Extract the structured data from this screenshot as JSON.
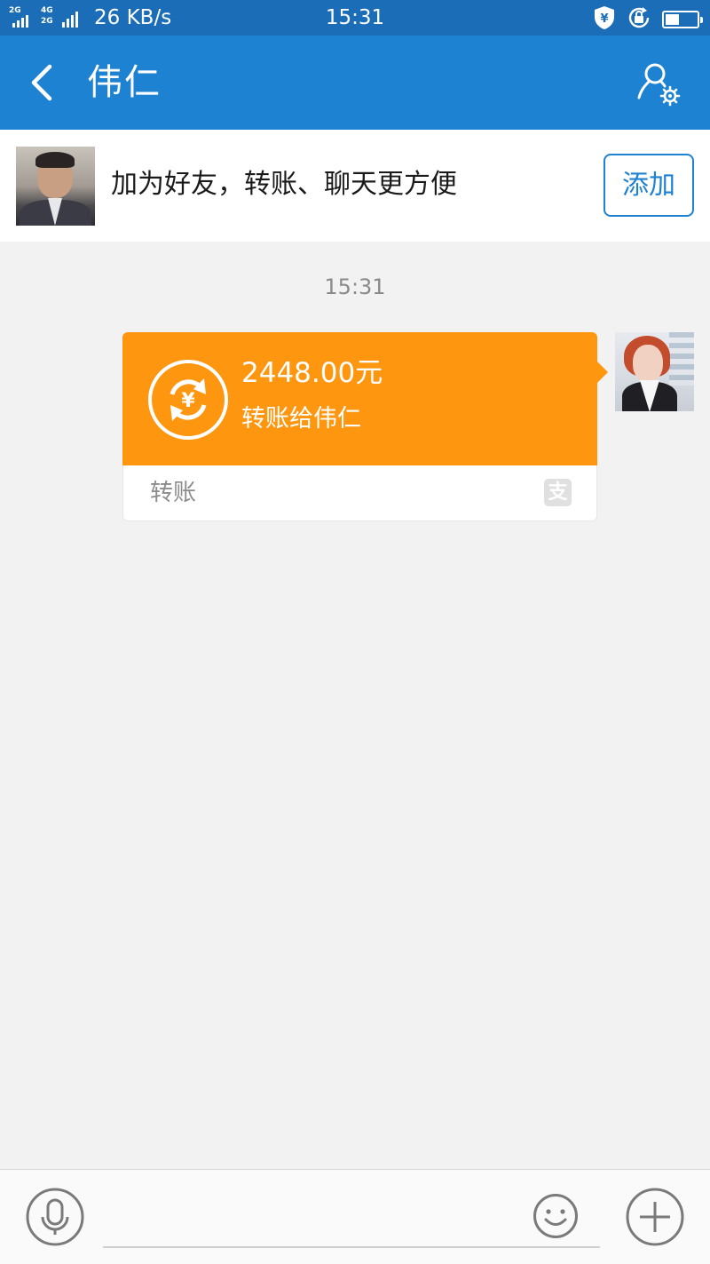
{
  "status_bar": {
    "sim1_network": "2G",
    "sim2_network_top": "4G",
    "sim2_network_bottom": "2G",
    "speed": "26 KB/s",
    "time": "15:31",
    "battery_level": 0.45,
    "icons": [
      "signal-icon",
      "signal-icon",
      "shield-yuan-icon",
      "lock-rotation-icon",
      "battery-icon"
    ]
  },
  "header": {
    "title": "伟仁",
    "back_icon": "chevron-left-icon",
    "profile_icon": "user-settings-icon",
    "bg_color": "#1e82d2"
  },
  "add_friend_banner": {
    "text": "加为好友，转账、聊天更方便",
    "button_label": "添加"
  },
  "chat": {
    "timestamp": "15:31",
    "messages": [
      {
        "type": "transfer",
        "direction": "outgoing",
        "amount": "2448.00元",
        "description": "转账给伟仁",
        "footer_label": "转账",
        "footer_icon": "alipay-icon",
        "footer_icon_glyph": "支",
        "color": "#ff9610"
      }
    ]
  },
  "input_bar": {
    "placeholder": "",
    "voice_icon": "microphone-icon",
    "emoji_icon": "smiley-icon",
    "plus_icon": "plus-icon"
  }
}
